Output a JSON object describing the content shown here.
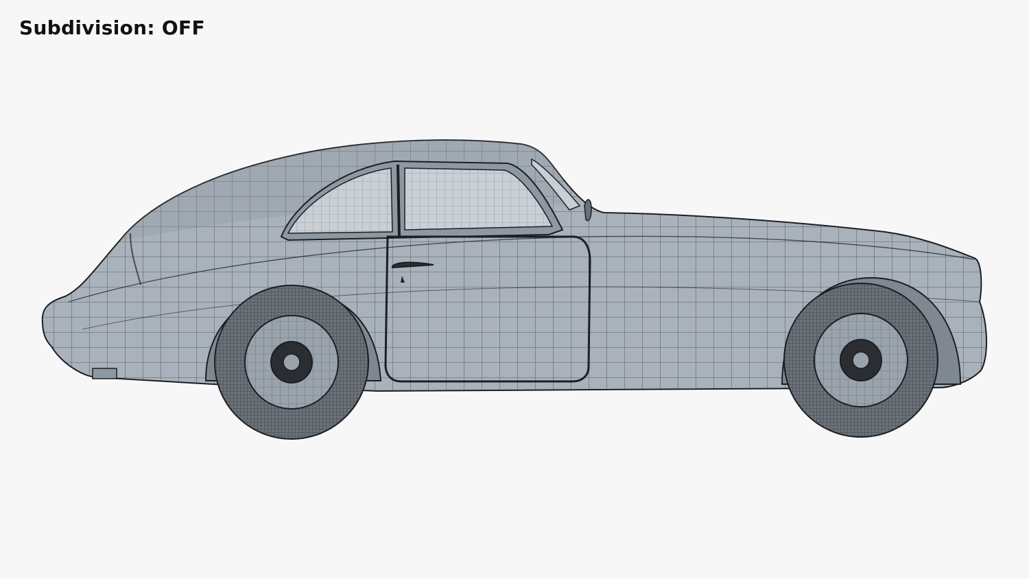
{
  "caption": {
    "label": "Subdivision: OFF"
  },
  "colors": {
    "background": "#f7f7f7",
    "body": "#a9b2bb",
    "body_shadow": "#8e98a2",
    "glass": "#c9cfd5",
    "wire": "#1b1f24",
    "tire": "#6b7178",
    "hub": "#2a2e33"
  }
}
